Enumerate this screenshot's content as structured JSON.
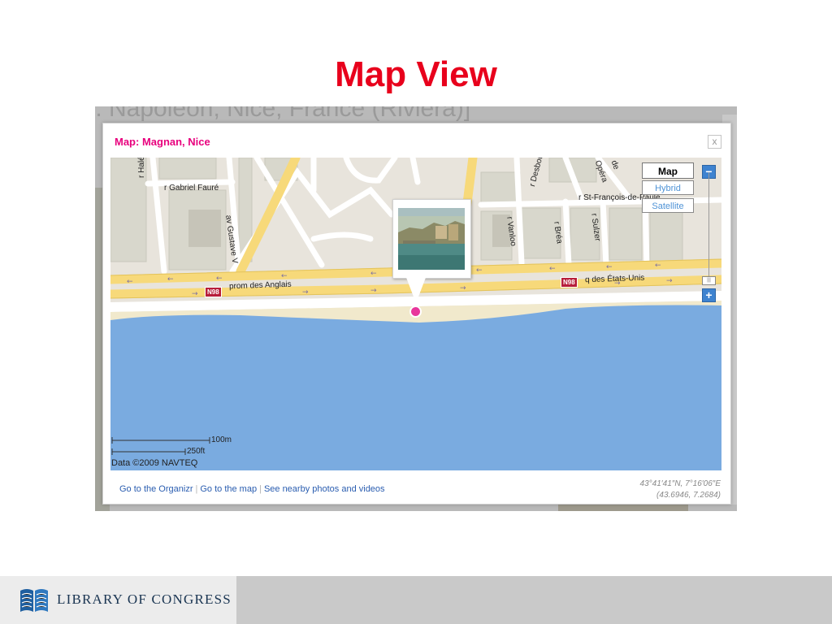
{
  "slide": {
    "title": "Map View"
  },
  "background_page": {
    "title_fragment": "r. Napoleon, Nice, France (Riviera)]"
  },
  "dialog": {
    "title": "Map: Magnan, Nice",
    "close_label": "x",
    "map": {
      "type_buttons": [
        "Map",
        "Hybrid",
        "Satellite"
      ],
      "active_type": "Map",
      "zoom_in_label": "+",
      "zoom_out_label": "−",
      "street_labels": [
        "r Halévy",
        "r Gabriel Fauré",
        "av Gustave V",
        "r Desbout",
        "Opéra",
        "de",
        "r St-François-de-Paule",
        "r Vanloo",
        "r Bréa",
        "r Sulzer",
        "prom des Anglais",
        "q des États-Unis"
      ],
      "route_shields": [
        "N98",
        "N98"
      ],
      "scale": {
        "metric": "100m",
        "imperial": "250ft"
      },
      "copyright": "Data ©2009 NAVTEQ",
      "colors": {
        "sea": "#7aabe0",
        "beach": "#f1e9cc",
        "major_road": "#f7d97a",
        "land": "#e8e4dc",
        "block": "#d8d7cc",
        "pin": "#e8369c"
      }
    },
    "footer": {
      "links": [
        "Go to the Organizr",
        "Go to the map",
        "See nearby photos and videos"
      ],
      "coords_dms": "43°41′41″N, 7°16′06″E",
      "coords_decimal": "(43.6946, 7.2684)"
    }
  },
  "branding": {
    "logo_text": "LIBRARY OF CONGRESS",
    "logo_icon": "book-pages-icon"
  }
}
